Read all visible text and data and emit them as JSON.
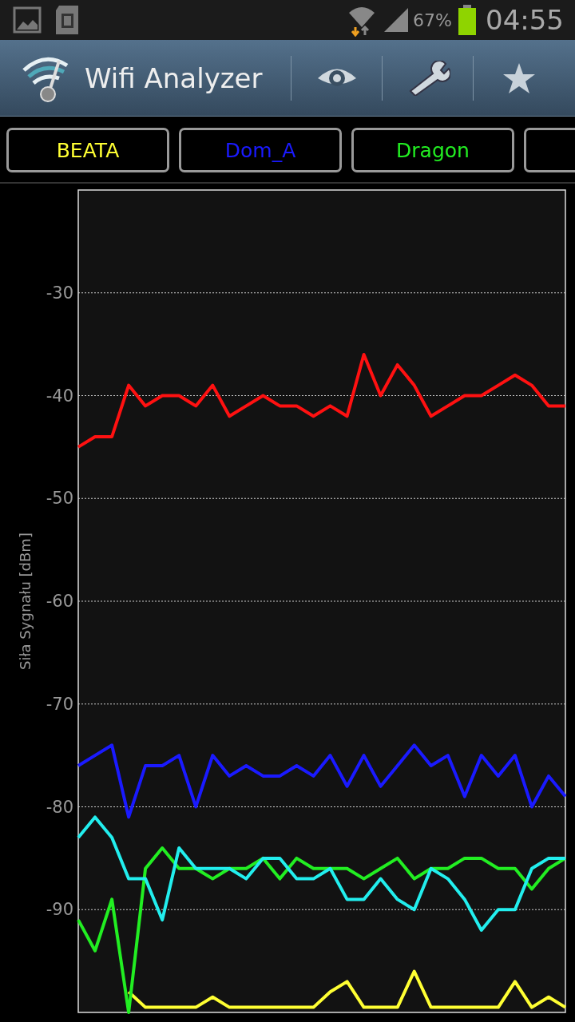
{
  "status_bar": {
    "battery": "67%",
    "time": "04:55"
  },
  "action_bar": {
    "title": "Wifi Analyzer"
  },
  "chart_data": {
    "type": "line",
    "ylabel": "Siła Sygnału [dBm]",
    "ylim": [
      -100,
      -20
    ],
    "yticks": [
      -90,
      -80,
      -70,
      -60,
      -50,
      -40,
      -30
    ],
    "grid": true,
    "series": [
      {
        "name": "BEATA",
        "color": "#ffff33",
        "values": [
          null,
          null,
          null,
          -98,
          -99.5,
          -99.5,
          -99.5,
          -99.5,
          -98.5,
          -99.5,
          -99.5,
          -99.5,
          -99.5,
          -99.5,
          -99.5,
          -98,
          -97,
          -99.5,
          -99.5,
          -99.5,
          -96,
          -99.5,
          -99.5,
          -99.5,
          -99.5,
          -99.5,
          -97,
          -99.5,
          -98.5,
          -99.5
        ]
      },
      {
        "name": "Dom_A",
        "color": "#1a1aff",
        "values": [
          -76,
          -75,
          -74,
          -81,
          -76,
          -76,
          -75,
          -80,
          -75,
          -77,
          -76,
          -77,
          -77,
          -76,
          -77,
          -75,
          -78,
          -75,
          -78,
          -76,
          -74,
          -76,
          -75,
          -79,
          -75,
          -77,
          -75,
          -80,
          -77,
          -79
        ]
      },
      {
        "name": "Dragon",
        "color": "#22ee22",
        "values": [
          -91,
          -94,
          -89,
          -100,
          -86,
          -84,
          -86,
          -86,
          -87,
          -86,
          -86,
          -85,
          -87,
          -85,
          -86,
          -86,
          -86,
          -87,
          -86,
          -85,
          -87,
          -86,
          -86,
          -85,
          -85,
          -86,
          -86,
          -88,
          -86,
          -85
        ]
      },
      {
        "color": "#ff1111",
        "values": [
          -45,
          -44,
          -44,
          -39,
          -41,
          -40,
          -40,
          -41,
          -39,
          -42,
          -41,
          -40,
          -41,
          -41,
          -42,
          -41,
          -42,
          -36,
          -40,
          -37,
          -39,
          -42,
          -41,
          -40,
          -40,
          -39,
          -38,
          -39,
          -41,
          -41
        ]
      },
      {
        "color": "#22eeee",
        "values": [
          -83,
          -81,
          -83,
          -87,
          -87,
          -91,
          -84,
          -86,
          -86,
          -86,
          -87,
          -85,
          -85,
          -87,
          -87,
          -86,
          -89,
          -89,
          -87,
          -89,
          -90,
          -86,
          -87,
          -89,
          -92,
          -90,
          -90,
          -86,
          -85,
          -85
        ]
      }
    ]
  }
}
